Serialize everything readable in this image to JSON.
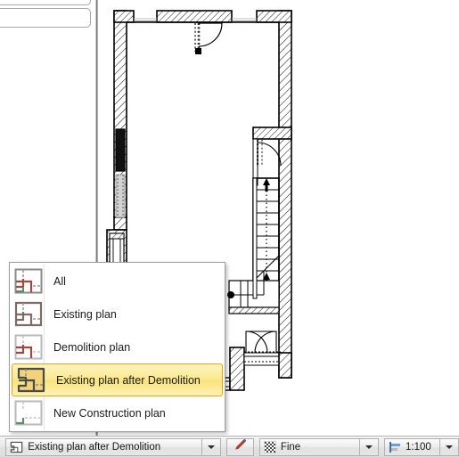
{
  "app": {
    "kind": "cad-floorplan-editor"
  },
  "left_panel": {
    "cards": [
      {
        "name": "panel-row-top"
      },
      {
        "name": "panel-row-second"
      }
    ]
  },
  "plan_menu": {
    "name": "plan-type-dropdown-menu",
    "items": [
      {
        "icon": "plan-all-icon",
        "label": "All",
        "selected": false
      },
      {
        "icon": "plan-existing-icon",
        "label": "Existing plan",
        "selected": false
      },
      {
        "icon": "plan-demolition-icon",
        "label": "Demolition plan",
        "selected": false
      },
      {
        "icon": "plan-existing-after-demolition-icon",
        "label": "Existing plan after Demolition",
        "selected": true
      },
      {
        "icon": "plan-new-construction-icon",
        "label": "New Construction plan",
        "selected": false
      }
    ]
  },
  "status_bar": {
    "plan_selector": {
      "icon": "plan-existing-after-demolition-icon",
      "value": "Existing plan after Demolition",
      "arrow": "chevron-down-icon"
    },
    "pen_button": {
      "icon": "marker-pen-icon"
    },
    "quality_selector": {
      "icon": "checker-pattern-icon",
      "value": "Fine",
      "arrow": "chevron-down-icon"
    },
    "scale_selector": {
      "icon": "scale-ruler-icon",
      "value": "1:100",
      "arrow": "chevron-down-icon"
    }
  },
  "colors": {
    "selection_highlight": "#fbe98d",
    "selection_border": "#e3a21a",
    "pen_red": "#d8452b",
    "menu_text": "#1b1b1b",
    "wall_black": "#000000",
    "demolition_red": "#9a4a41",
    "new_green": "#5a8f62",
    "existing_gray": "#9b9b9b"
  },
  "drawing": {
    "name": "floor-plan-drawing",
    "description": "Architectural floor plan, existing plan after demolition view",
    "elements": [
      "exterior-walls-hatched",
      "top-wall-openings",
      "interior-door-swing-top",
      "left-window",
      "stair-run-with-direction-arrows",
      "under-stair-storage",
      "bottom-entry-door",
      "bottom-window-band"
    ]
  }
}
